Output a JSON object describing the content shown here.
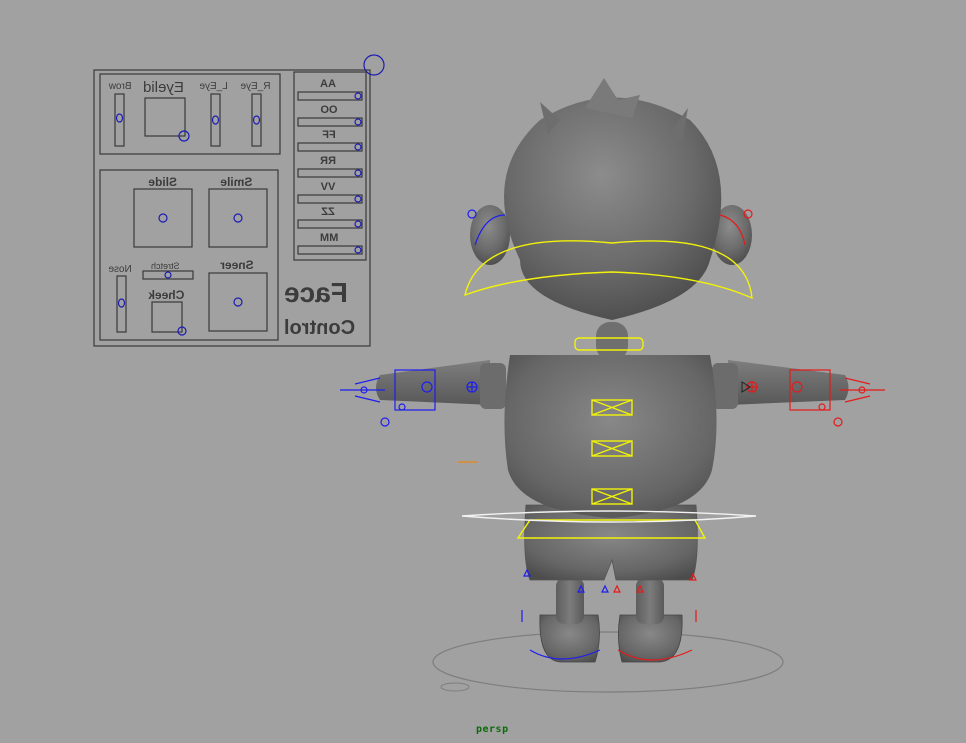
{
  "viewport": {
    "camera_label": "persp",
    "background_color": "#a1a1a1"
  },
  "face_control": {
    "title": "Face",
    "subtitle": "Control",
    "eye_section": {
      "brow": "Brow",
      "eyelid": "Eyelid",
      "l_eye": "L_Eye",
      "r_eye": "R_Eye"
    },
    "mouth_section": {
      "slide": "Slide",
      "smile": "Smile",
      "sneer": "Sneer",
      "nose": "Nose",
      "stretch": "Stretch",
      "cheek": "Cheek"
    },
    "phonemes": [
      "AA",
      "OO",
      "FF",
      "RR",
      "VV",
      "ZZ",
      "MM"
    ]
  },
  "colors": {
    "knob": "#1b1bb4",
    "yellow_controls": "#f2f20a",
    "left_side_controls": "#1e1ef0",
    "right_side_controls": "#e61a1a",
    "character_mesh": "#6e6e6e",
    "camera_label": "#0b6b0b"
  },
  "icons": [
    "circle-control-icon",
    "box-cross-control-icon",
    "arrow-locator-icon"
  ]
}
